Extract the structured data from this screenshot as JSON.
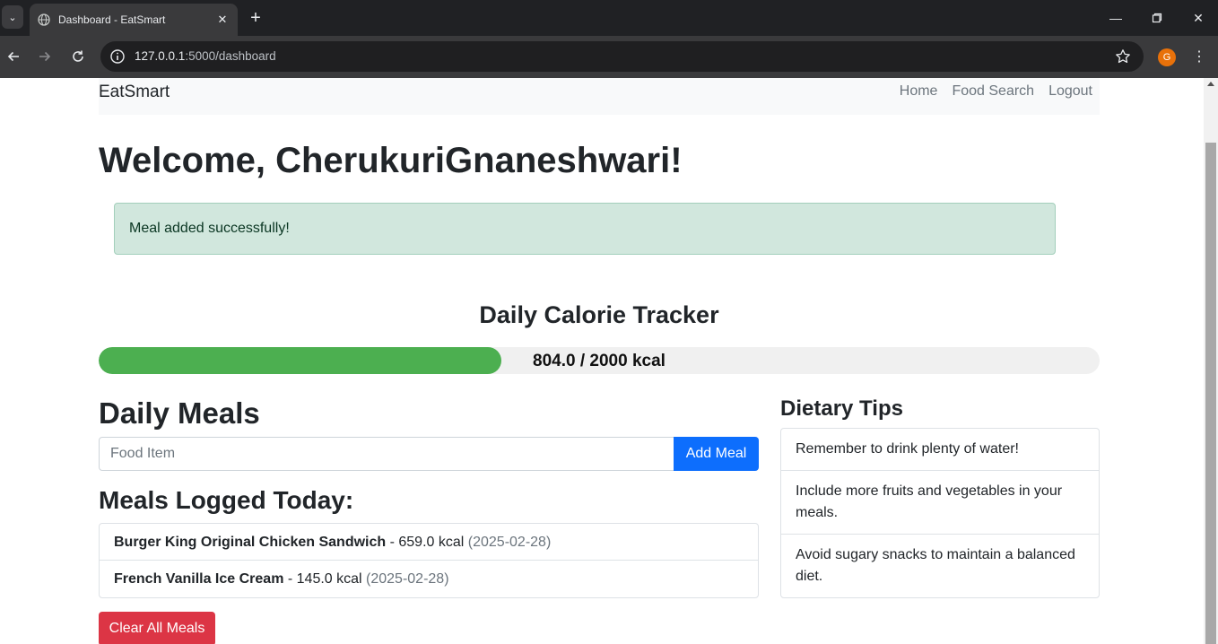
{
  "browser": {
    "tab_title": "Dashboard - EatSmart",
    "url_host": "127.0.0.1",
    "url_path": ":5000/dashboard",
    "profile_initial": "G"
  },
  "navbar": {
    "brand": "EatSmart",
    "links": [
      "Home",
      "Food Search",
      "Logout"
    ]
  },
  "welcome": "Welcome, CherukuriGnaneshwari!",
  "alert": "Meal added successfully!",
  "tracker": {
    "title": "Daily Calorie Tracker",
    "consumed": 804.0,
    "goal": 2000,
    "label": "804.0 / 2000 kcal",
    "fill_color": "#4caf50"
  },
  "meals_form": {
    "heading": "Daily Meals",
    "placeholder": "Food Item",
    "button": "Add Meal"
  },
  "logged": {
    "heading": "Meals Logged Today:",
    "items": [
      {
        "name": "Burger King Original Chicken Sandwich",
        "kcal": " - 659.0 kcal ",
        "date": "(2025-02-28)"
      },
      {
        "name": "French Vanilla Ice Cream",
        "kcal": " - 145.0 kcal ",
        "date": "(2025-02-28)"
      }
    ]
  },
  "clear_button": "Clear All Meals",
  "tips": {
    "heading": "Dietary Tips",
    "items": [
      "Remember to drink plenty of water!",
      "Include more fruits and vegetables in your meals.",
      "Avoid sugary snacks to maintain a balanced diet."
    ]
  },
  "colors": {
    "primary": "#0d6efd",
    "danger": "#dc3545",
    "success_bg": "#d1e7dd"
  }
}
